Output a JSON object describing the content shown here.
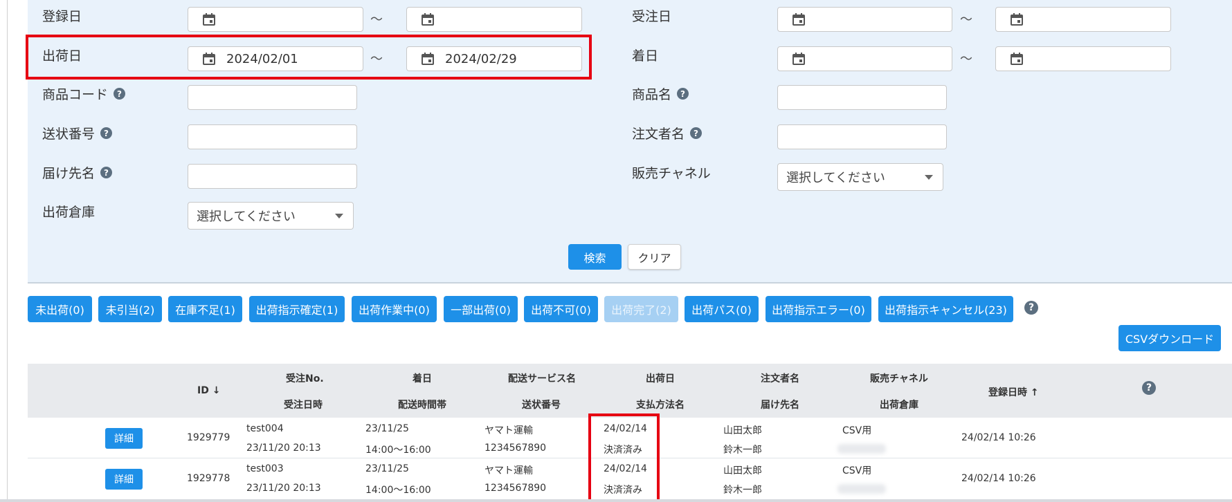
{
  "search": {
    "registration_date": {
      "label": "登録日",
      "from": "",
      "to": ""
    },
    "order_date": {
      "label": "受注日",
      "from": "",
      "to": ""
    },
    "ship_date": {
      "label": "出荷日",
      "from": "2024/02/01",
      "to": "2024/02/29"
    },
    "arrival_date": {
      "label": "着日",
      "from": "",
      "to": ""
    },
    "product_code": {
      "label": "商品コード",
      "value": ""
    },
    "product_name": {
      "label": "商品名",
      "value": ""
    },
    "tracking_number": {
      "label": "送状番号",
      "value": ""
    },
    "orderer_name": {
      "label": "注文者名",
      "value": ""
    },
    "recipient_name": {
      "label": "届け先名",
      "value": ""
    },
    "sales_channel": {
      "label": "販売チャネル",
      "selected": "選択してください"
    },
    "warehouse": {
      "label": "出荷倉庫",
      "selected": "選択してください"
    },
    "range_sep": "～",
    "search_button": "検索",
    "clear_button": "クリア"
  },
  "status_filters": [
    {
      "label": "未出荷(0)",
      "enabled": true
    },
    {
      "label": "未引当(2)",
      "enabled": true
    },
    {
      "label": "在庫不足(1)",
      "enabled": true
    },
    {
      "label": "出荷指示確定(1)",
      "enabled": true
    },
    {
      "label": "出荷作業中(0)",
      "enabled": true
    },
    {
      "label": "一部出荷(0)",
      "enabled": true
    },
    {
      "label": "出荷不可(0)",
      "enabled": true
    },
    {
      "label": "出荷完了(2)",
      "enabled": false
    },
    {
      "label": "出荷パス(0)",
      "enabled": true
    },
    {
      "label": "出荷指示エラー(0)",
      "enabled": true
    },
    {
      "label": "出荷指示キャンセル(23)",
      "enabled": true
    }
  ],
  "csv_button": "CSVダウンロード",
  "table": {
    "headers": {
      "id": "ID",
      "order_no": "受注No.",
      "order_datetime": "受注日時",
      "arrival": "着日",
      "delivery_time": "配送時間帯",
      "service": "配送サービス名",
      "tracking": "送状番号",
      "ship_date": "出荷日",
      "payment": "支払方法名",
      "orderer": "注文者名",
      "recipient": "届け先名",
      "channel": "販売チャネル",
      "warehouse": "出荷倉庫",
      "registered": "登録日時"
    },
    "rows": [
      {
        "detail": "詳細",
        "id": "1929779",
        "order_no": "test004",
        "order_datetime": "23/11/20 20:13",
        "arrival": "23/11/25",
        "delivery_time": "14:00〜16:00",
        "service": "ヤマト運輸",
        "tracking": "1234567890",
        "ship_date": "24/02/14",
        "payment": "決済済み",
        "orderer": "山田太郎",
        "recipient": "鈴木一郎",
        "channel": "CSV用",
        "registered": "24/02/14 10:26"
      },
      {
        "detail": "詳細",
        "id": "1929778",
        "order_no": "test003",
        "order_datetime": "23/11/20 20:13",
        "arrival": "23/11/25",
        "delivery_time": "14:00〜16:00",
        "service": "ヤマト運輸",
        "tracking": "1234567890",
        "ship_date": "24/02/14",
        "payment": "決済済み",
        "orderer": "山田太郎",
        "recipient": "鈴木一郎",
        "channel": "CSV用",
        "registered": "24/02/14 10:26"
      }
    ]
  },
  "colors": {
    "primary": "#1e90e8",
    "highlight": "#e60012",
    "panel": "#e9f2fb"
  }
}
